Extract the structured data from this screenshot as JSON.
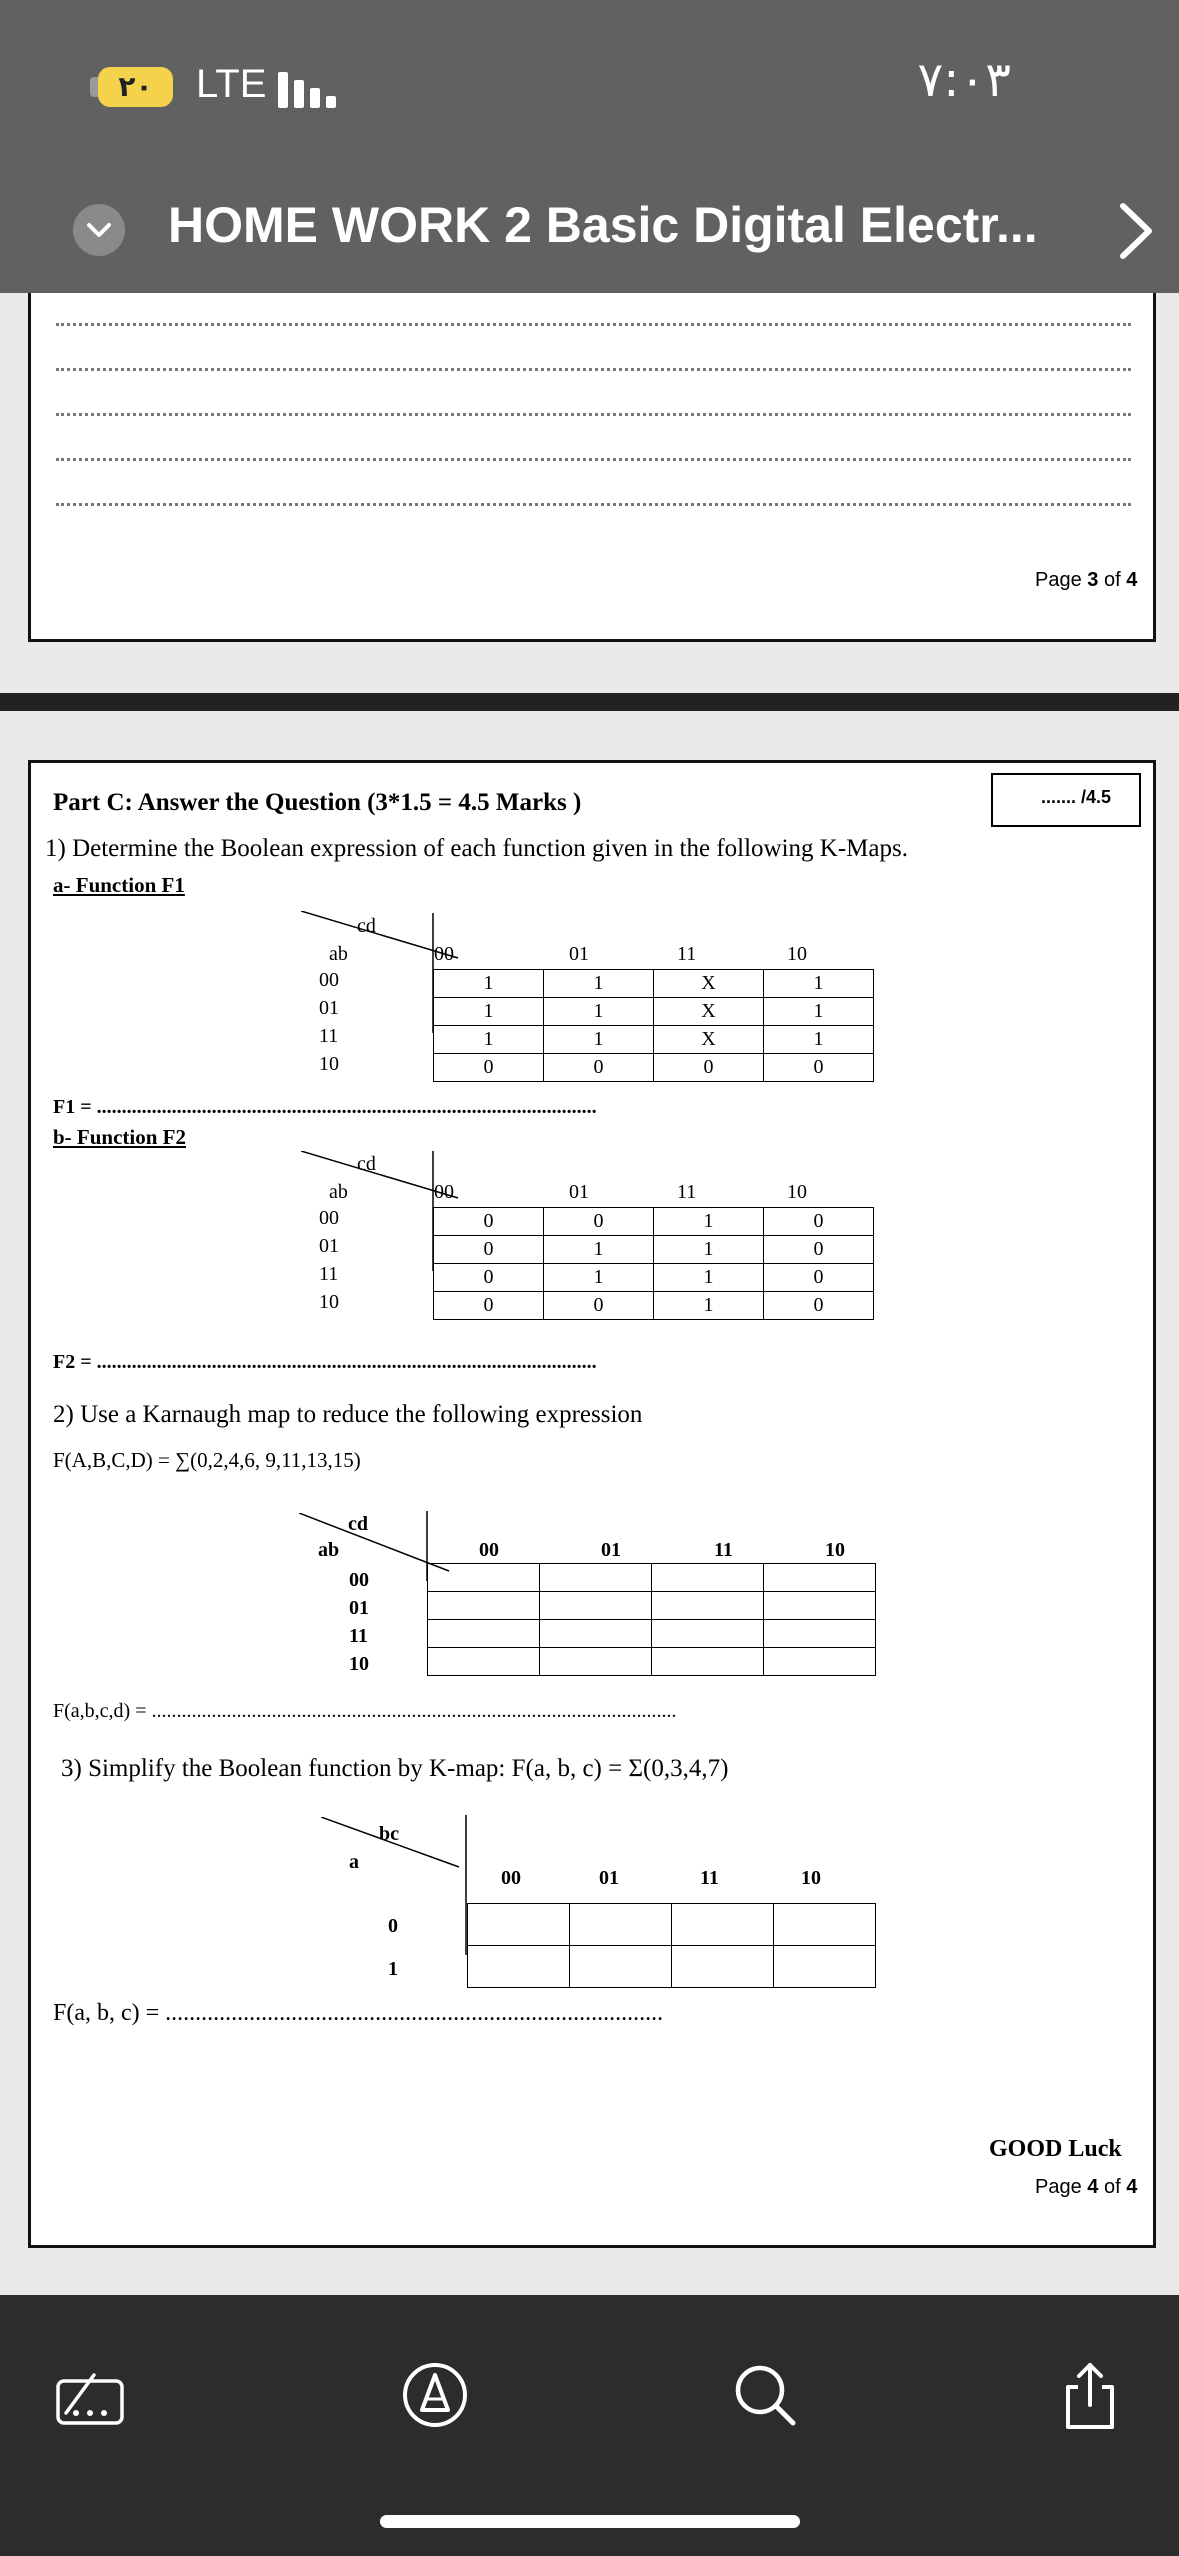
{
  "status_bar": {
    "battery_level": "٢٠",
    "network": "LTE",
    "time": "٧:٠٣"
  },
  "nav": {
    "title": "HOME WORK 2 Basic Digital Electr..."
  },
  "page3": {
    "page_label_prefix": "Page ",
    "page_num": "3",
    "page_label_mid": " of ",
    "page_total": "4"
  },
  "page4": {
    "marks_box": "....... /4.5",
    "part_title": "Part C:  Answer the Question   (3*1.5 = 4.5 Marks )",
    "q1": "1)  Determine the Boolean expression of each function given in the following K-Maps.",
    "q1a": "a- Function F1",
    "q1b": "b- Function F2",
    "f1_line": "F1 = ....................................................................................................",
    "f2_line": "F2 = ....................................................................................................",
    "kmap_var_cd": "cd",
    "kmap_var_ab": "ab",
    "kmap_cols": [
      "00",
      "01",
      "11",
      "10"
    ],
    "kmap_rows": [
      "00",
      "01",
      "11",
      "10"
    ],
    "f1_cells": [
      [
        "1",
        "1",
        "X",
        "1"
      ],
      [
        "1",
        "1",
        "X",
        "1"
      ],
      [
        "1",
        "1",
        "X",
        "1"
      ],
      [
        "0",
        "0",
        "0",
        "0"
      ]
    ],
    "f2_cells": [
      [
        "0",
        "0",
        "1",
        "0"
      ],
      [
        "0",
        "1",
        "1",
        "0"
      ],
      [
        "0",
        "1",
        "1",
        "0"
      ],
      [
        "0",
        "0",
        "1",
        "0"
      ]
    ],
    "q2": "2)   Use a Karnaugh map to reduce the following expression",
    "q2_expr": "F(A,B,C,D) = ∑(0,2,4,6, 9,11,13,15)",
    "q2_line": "F(a,b,c,d)   = .........................................................................................................",
    "q3": "3)  Simplify the Boolean function by K-map: F(a, b, c) = Σ(0,3,4,7)",
    "q3_var_bc": "bc",
    "q3_var_a": "a",
    "q3_cols": [
      "00",
      "01",
      "11",
      "10"
    ],
    "q3_rows": [
      "0",
      "1"
    ],
    "q3_line": "F(a, b, c)   = ...................................................................................",
    "good_luck": "GOOD Luck",
    "page_label_prefix": "Page ",
    "page_num": "4",
    "page_label_mid": " of ",
    "page_total": "4"
  },
  "toolbar": {
    "icons": [
      "markup-icon",
      "annotate-icon",
      "search-icon",
      "share-icon"
    ]
  }
}
